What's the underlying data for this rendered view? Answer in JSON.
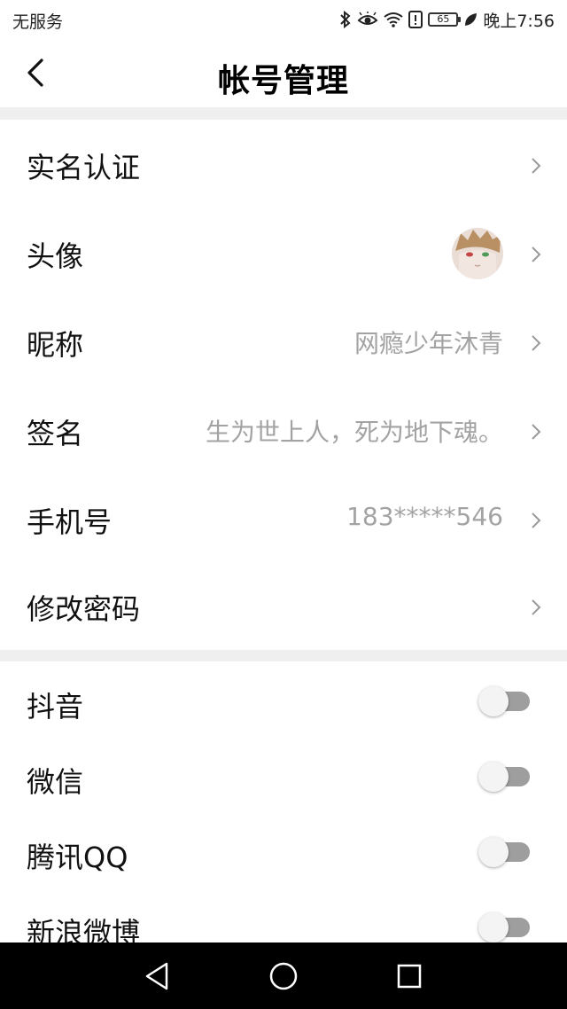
{
  "status_bar": {
    "carrier": "无服务",
    "battery": "65",
    "time": "晚上7:56"
  },
  "header": {
    "title": "帐号管理"
  },
  "settings": [
    {
      "label": "实名认证",
      "value": ""
    },
    {
      "label": "头像",
      "value": ""
    },
    {
      "label": "昵称",
      "value": "网瘾少年沐青"
    },
    {
      "label": "签名",
      "value": "生为世上人，死为地下魂。"
    },
    {
      "label": "手机号",
      "value": "183*****546"
    },
    {
      "label": "修改密码",
      "value": ""
    }
  ],
  "bindings": [
    {
      "label": "抖音",
      "enabled": false
    },
    {
      "label": "微信",
      "enabled": false
    },
    {
      "label": "腾讯QQ",
      "enabled": false
    },
    {
      "label": "新浪微博",
      "enabled": false
    }
  ],
  "colors": {
    "value_text": "#a3a3a3",
    "section_divider": "#efefef",
    "toggle_off_track": "#9e9e9e"
  },
  "icons": [
    "bluetooth-icon",
    "eye-comfort-icon",
    "wifi-icon",
    "alert-icon",
    "battery-icon",
    "leaf-icon",
    "back-icon",
    "chevron-right-icon",
    "nav-back-icon",
    "nav-home-icon",
    "nav-recents-icon"
  ]
}
